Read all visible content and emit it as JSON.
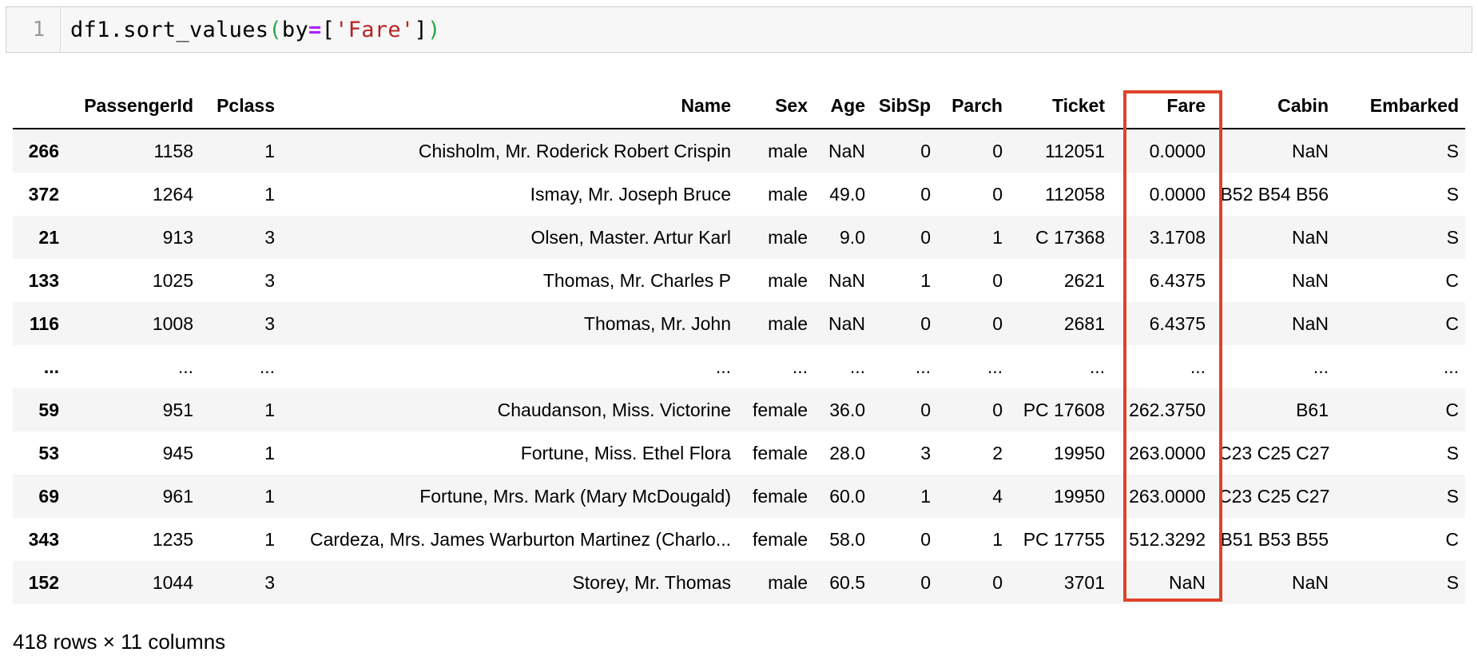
{
  "code_cell": {
    "line_number": "1",
    "tokens": {
      "var": "df1.sort_values",
      "open_paren": "(",
      "kw": "by",
      "op": "=",
      "open_bracket": "[",
      "string": "'Fare'",
      "close_bracket": "]",
      "close_paren": ")"
    }
  },
  "table": {
    "columns": [
      "PassengerId",
      "Pclass",
      "Name",
      "Sex",
      "Age",
      "SibSp",
      "Parch",
      "Ticket",
      "Fare",
      "Cabin",
      "Embarked"
    ],
    "rows": [
      {
        "index": "266",
        "cells": [
          "1158",
          "1",
          "Chisholm, Mr. Roderick Robert Crispin",
          "male",
          "NaN",
          "0",
          "0",
          "112051",
          "0.0000",
          "NaN",
          "S"
        ]
      },
      {
        "index": "372",
        "cells": [
          "1264",
          "1",
          "Ismay, Mr. Joseph Bruce",
          "male",
          "49.0",
          "0",
          "0",
          "112058",
          "0.0000",
          "B52 B54 B56",
          "S"
        ]
      },
      {
        "index": "21",
        "cells": [
          "913",
          "3",
          "Olsen, Master. Artur Karl",
          "male",
          "9.0",
          "0",
          "1",
          "C 17368",
          "3.1708",
          "NaN",
          "S"
        ]
      },
      {
        "index": "133",
        "cells": [
          "1025",
          "3",
          "Thomas, Mr. Charles P",
          "male",
          "NaN",
          "1",
          "0",
          "2621",
          "6.4375",
          "NaN",
          "C"
        ]
      },
      {
        "index": "116",
        "cells": [
          "1008",
          "3",
          "Thomas, Mr. John",
          "male",
          "NaN",
          "0",
          "0",
          "2681",
          "6.4375",
          "NaN",
          "C"
        ]
      },
      {
        "index": "...",
        "cells": [
          "...",
          "...",
          "...",
          "...",
          "...",
          "...",
          "...",
          "...",
          "...",
          "...",
          "..."
        ]
      },
      {
        "index": "59",
        "cells": [
          "951",
          "1",
          "Chaudanson, Miss. Victorine",
          "female",
          "36.0",
          "0",
          "0",
          "PC 17608",
          "262.3750",
          "B61",
          "C"
        ]
      },
      {
        "index": "53",
        "cells": [
          "945",
          "1",
          "Fortune, Miss. Ethel Flora",
          "female",
          "28.0",
          "3",
          "2",
          "19950",
          "263.0000",
          "C23 C25 C27",
          "S"
        ]
      },
      {
        "index": "69",
        "cells": [
          "961",
          "1",
          "Fortune, Mrs. Mark (Mary McDougald)",
          "female",
          "60.0",
          "1",
          "4",
          "19950",
          "263.0000",
          "C23 C25 C27",
          "S"
        ]
      },
      {
        "index": "343",
        "cells": [
          "1235",
          "1",
          "Cardeza, Mrs. James Warburton Martinez (Charlo...",
          "female",
          "58.0",
          "0",
          "1",
          "PC 17755",
          "512.3292",
          "B51 B53 B55",
          "C"
        ]
      },
      {
        "index": "152",
        "cells": [
          "1044",
          "3",
          "Storey, Mr. Thomas",
          "male",
          "60.5",
          "0",
          "0",
          "3701",
          "NaN",
          "NaN",
          "S"
        ]
      }
    ]
  },
  "highlight": {
    "column": "Fare",
    "color": "#e0412b"
  },
  "footer": "418 rows × 11 columns"
}
